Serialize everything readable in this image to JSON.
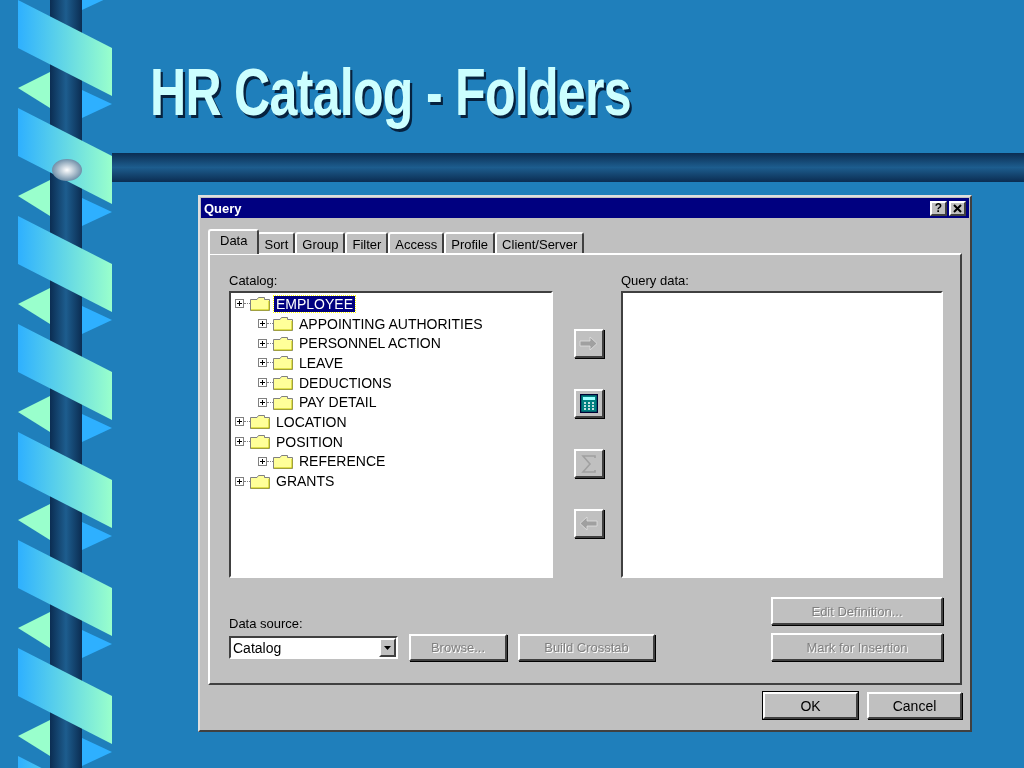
{
  "slide": {
    "title": "HR Catalog - Folders"
  },
  "dialog": {
    "title": "Query",
    "help_button": "?",
    "tabs": [
      {
        "label": "Data",
        "selected": true
      },
      {
        "label": "Sort",
        "selected": false
      },
      {
        "label": "Group",
        "selected": false
      },
      {
        "label": "Filter",
        "selected": false
      },
      {
        "label": "Access",
        "selected": false
      },
      {
        "label": "Profile",
        "selected": false
      },
      {
        "label": "Client/Server",
        "selected": false
      }
    ],
    "catalog": {
      "label": "Catalog:",
      "tree": [
        {
          "label": "EMPLOYEE",
          "selected": true,
          "expanded": false,
          "children": [
            {
              "label": "APPOINTING AUTHORITIES",
              "selected": false,
              "expanded": false
            },
            {
              "label": "PERSONNEL ACTION",
              "selected": false,
              "expanded": false
            },
            {
              "label": "LEAVE",
              "selected": false,
              "expanded": false
            },
            {
              "label": "DEDUCTIONS",
              "selected": false,
              "expanded": false
            },
            {
              "label": "PAY DETAIL",
              "selected": false,
              "expanded": false
            }
          ]
        },
        {
          "label": "LOCATION",
          "selected": false,
          "expanded": false
        },
        {
          "label": "POSITION",
          "selected": false,
          "expanded": false,
          "children": [
            {
              "label": "REFERENCE",
              "selected": false,
              "expanded": false
            }
          ]
        },
        {
          "label": "GRANTS",
          "selected": false,
          "expanded": false
        }
      ]
    },
    "tool_buttons": [
      {
        "kind": "add",
        "disabled": true
      },
      {
        "kind": "calculator",
        "disabled": false
      },
      {
        "kind": "sum",
        "disabled": true
      },
      {
        "kind": "remove",
        "disabled": true
      }
    ],
    "query_data": {
      "label": "Query data:"
    },
    "data_source": {
      "label": "Data source:",
      "value": "Catalog"
    },
    "buttons": [
      {
        "label": "Browse...",
        "disabled": true
      },
      {
        "label": "Build Crosstab",
        "disabled": true
      }
    ],
    "side_buttons": [
      {
        "label": "Edit Definition...",
        "disabled": true
      },
      {
        "label": "Mark for Insertion",
        "disabled": true
      }
    ],
    "footer_buttons": [
      {
        "label": "OK",
        "default": true
      },
      {
        "label": "Cancel",
        "default": false
      }
    ]
  }
}
